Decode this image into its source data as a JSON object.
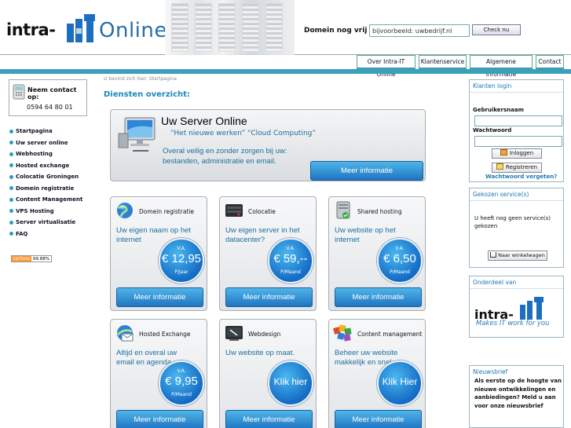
{
  "header": {
    "logo_text": "intra-IT",
    "brand_suffix": "Online",
    "domain_label": "Domein nog vrij ??",
    "domain_input_value": "bijvoorbeeld: uwbedrijf.nl",
    "check_button": "Check nu"
  },
  "topnav": {
    "items": [
      "Over Intra-IT Online",
      "Klantenservice",
      "Algemene informatie",
      "Contact"
    ]
  },
  "contact": {
    "title": "Neem contact op:",
    "phone": "0594 64 80 01"
  },
  "left_nav": {
    "items": [
      "Startpagina",
      "Uw server online",
      "Webhosting",
      "Hosted exchange",
      "Colocatie Groningen",
      "Domein registratie",
      "Content Management",
      "VPS Hosting",
      "Server virtualisatie",
      "FAQ"
    ]
  },
  "uptime": {
    "label": "UpTime",
    "value": "99.88%"
  },
  "main": {
    "breadcrumb": "U bevind zich hier: Startpagina",
    "title": "Diensten overzicht:",
    "hero": {
      "title": "Uw Server Online",
      "subtitle": "“Het nieuwe werken” “Cloud Computing”",
      "text": "Overal veilig en zonder zorgen bij uw: bestanden, administratie en email.",
      "button": "Meer informatie"
    },
    "cards": [
      {
        "title": "Domein registratie",
        "text": "Uw eigen naam op het internet",
        "va": "V.A.",
        "price": "€ 12,95",
        "period": "P/Jaar",
        "button": "Meer informatie",
        "icon": "globe-icon"
      },
      {
        "title": "Colocatie",
        "text": "Uw eigen server in het datacenter?",
        "va": "V.A.",
        "price": "€ 59,--",
        "period": "P/Maand",
        "button": "Meer informatie",
        "icon": "server-icon"
      },
      {
        "title": "Shared hosting",
        "text": "Uw website op het internet",
        "va": "V.A.",
        "price": "€  6,50",
        "period": "P/Maand",
        "button": "Meer informatie",
        "icon": "hosting-icon"
      },
      {
        "title": "Hosted Exchange",
        "text": "Altijd en overal uw email en agenda.",
        "va": "V.A.",
        "price": "€ 9,95",
        "period": "P/Maand",
        "button": "Meer informatie",
        "icon": "mail-icon"
      },
      {
        "title": "Webdesign",
        "text": "Uw website op maat.",
        "va": "",
        "price": "Klik hier",
        "period": "",
        "button": "Meer informatie",
        "icon": "design-icon"
      },
      {
        "title": "Content management",
        "text": "Beheer uw website makkelijk en snel",
        "va": "",
        "price": "Klik Hier",
        "period": "",
        "button": "Meer informatie",
        "icon": "cms-icon"
      }
    ]
  },
  "login": {
    "title": "Klanten login",
    "username_label": "Gebruikersnaam",
    "password_label": "Wachtwoord",
    "login_button": "Inloggen",
    "register_button": "Registreren",
    "forgot": "Wachtwoord vergeten?"
  },
  "services": {
    "title": "Gekozen service(s)",
    "text": "U heeft nog geen service(s) gekozen",
    "cart_button": "Naar winkelwagen"
  },
  "partner": {
    "title": "Onderdeel van",
    "logo_text": "intra-IT",
    "slogan": "Makes IT work for you"
  },
  "news": {
    "title": "Nieuwsbrief",
    "text": "Als eerste op de hoogte van nieuwe ontwikkelingen en aanbiedingen? Meld u aan voor onze nieuwsbrief"
  },
  "colors": {
    "accent": "#2aa0bd",
    "button": "#1f74c2",
    "text_blue": "#1e6fa0"
  }
}
